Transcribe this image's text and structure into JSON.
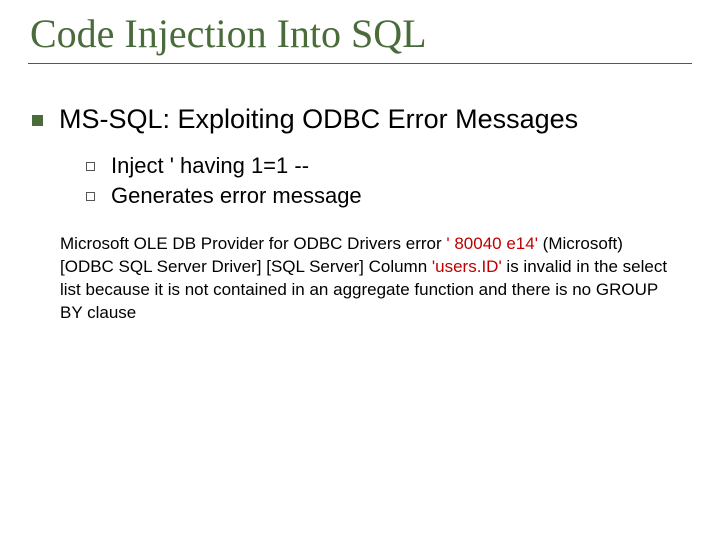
{
  "title": "Code Injection Into SQL",
  "l1": "MS-SQL: Exploiting ODBC Error Messages",
  "l2a": "Inject ' having 1=1 --",
  "l2b": "Generates error message",
  "para1a": "Microsoft OLE DB Provider for ODBC Drivers error ",
  "para1b": "' 80040 e14'",
  "para1c": " (Microsoft) [ODBC SQL Server Driver] [SQL Server] Column ",
  "para1d": "'users.ID'",
  "para1e": " is invalid in the select list because it is not contained in an aggregate function and there is no GROUP BY clause"
}
